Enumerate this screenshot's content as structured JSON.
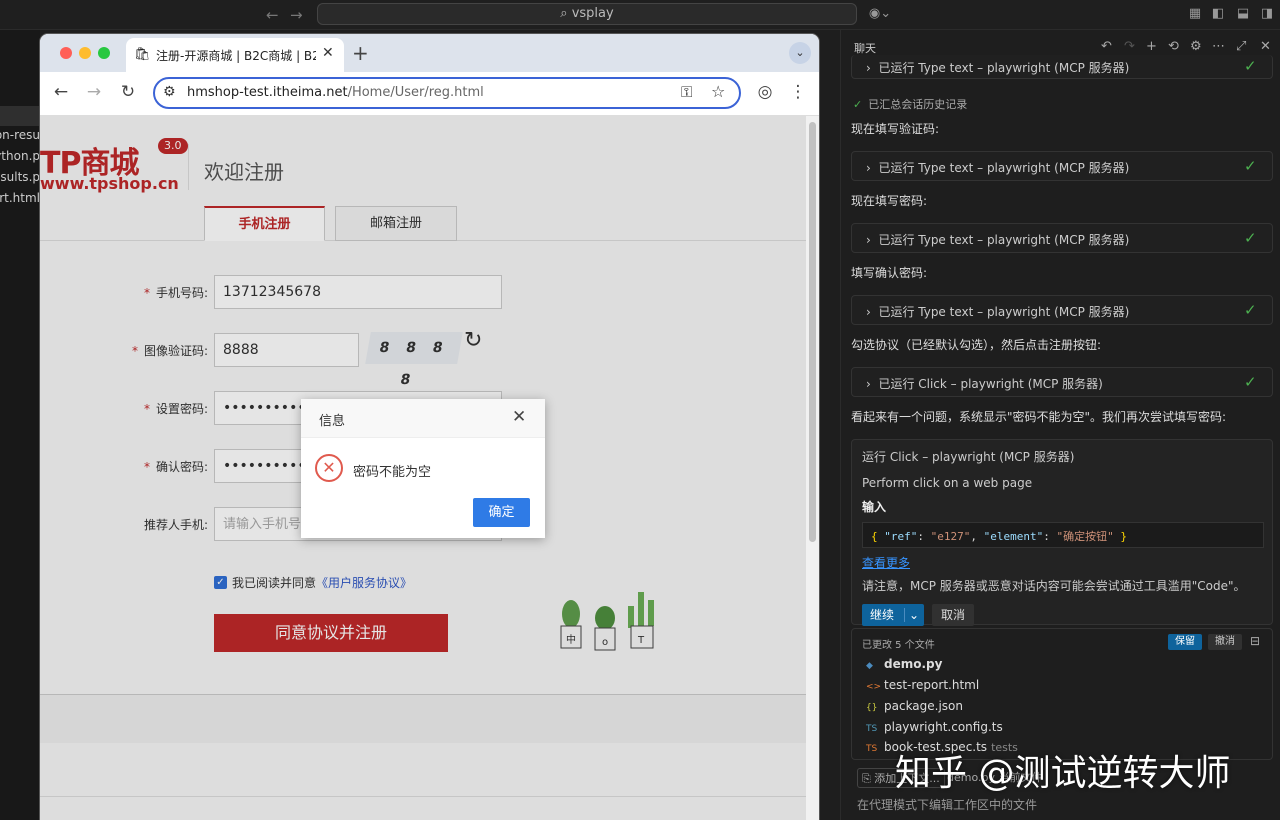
{
  "vscode": {
    "search_text": "vsplay",
    "back_icon": "arrow-left-icon",
    "forward_icon": "arrow-right-icon"
  },
  "explorer": {
    "files": [
      "on-resu",
      "ython.p",
      "esults.p",
      "ort.html"
    ]
  },
  "browser": {
    "tab_title": "注册-开源商城 | B2C商城 | B2B",
    "url_host": "hmshop-test.itheima.net",
    "url_path": "/Home/User/reg.html"
  },
  "page": {
    "logo": "TP商城",
    "logo_badge": "3.0",
    "logo_url": "www.tpshop.cn",
    "welcome": "欢迎注册",
    "tabs": [
      {
        "label": "手机注册",
        "active": true
      },
      {
        "label": "邮箱注册",
        "active": false
      }
    ],
    "fields": {
      "phone_label": "手机号码:",
      "phone_value": "13712345678",
      "captcha_label": "图像验证码:",
      "captcha_value": "8888",
      "captcha_image": "8 8 8 8",
      "password_label": "设置密码:",
      "password_value": "••••••••••",
      "confirm_label": "确认密码:",
      "confirm_value": "••••••••••",
      "referrer_label": "推荐人手机:",
      "referrer_placeholder": "请输入手机号"
    },
    "required_mark": "*",
    "agree_text": "我已阅读并同意",
    "agree_link": "《用户服务协议》",
    "agree_checked": true,
    "register_button": "同意协议并注册",
    "cacti_labels": [
      "中",
      "o",
      "T"
    ]
  },
  "dialog": {
    "title": "信息",
    "message": "密码不能为空",
    "ok_button": "确定"
  },
  "chat": {
    "title": "聊天",
    "tool_calls": [
      "已运行 Type text – playwright (MCP 服务器)",
      "已运行 Type text – playwright (MCP 服务器)",
      "已运行 Type text – playwright (MCP 服务器)",
      "已运行 Type text – playwright (MCP 服务器)",
      "已运行 Click – playwright (MCP 服务器)"
    ],
    "history_summary": "已汇总会话历史记录",
    "messages": [
      "现在填写验证码:",
      "现在填写密码:",
      "填写确认密码:",
      "勾选协议（已经默认勾选），然后点击注册按钮:",
      "看起来有一个问题，系统显示\"密码不能为空\"。我们再次尝试填写密码:"
    ],
    "confirm": {
      "title": "运行 Click – playwright (MCP 服务器)",
      "desc": "Perform click on a web page",
      "input_label": "输入",
      "code_ref_key": "\"ref\"",
      "code_ref_val": "\"e127\"",
      "code_el_key": "\"element\"",
      "code_el_val": "\"确定按钮\"",
      "see_more": "查看更多",
      "warning": "请注意，MCP 服务器或恶意对话内容可能会尝试通过工具滥用\"Code\"。",
      "continue": "继续",
      "cancel": "取消"
    },
    "changes": {
      "header": "已更改 5 个文件",
      "keep": "保留",
      "undo": "撤消",
      "files": [
        {
          "name": "demo.py",
          "icon": "python-icon",
          "dir": ""
        },
        {
          "name": "test-report.html",
          "icon": "html-icon",
          "dir": ""
        },
        {
          "name": "package.json",
          "icon": "json-icon",
          "dir": ""
        },
        {
          "name": "playwright.config.ts",
          "icon": "ts-icon",
          "dir": ""
        },
        {
          "name": "book-test.spec.ts",
          "icon": "ts-icon",
          "dir": "tests"
        }
      ]
    },
    "context_add": "添加上下文...",
    "context_file": "demo.py 当前文件",
    "prompt_placeholder": "在代理模式下编辑工作区中的文件"
  },
  "watermark": "知乎 @测试逆转大师",
  "colors": {
    "brand_red": "#c0292a",
    "accent_blue": "#2f7be6",
    "success_green": "#4caf50",
    "vscode_blue": "#0e639c"
  }
}
